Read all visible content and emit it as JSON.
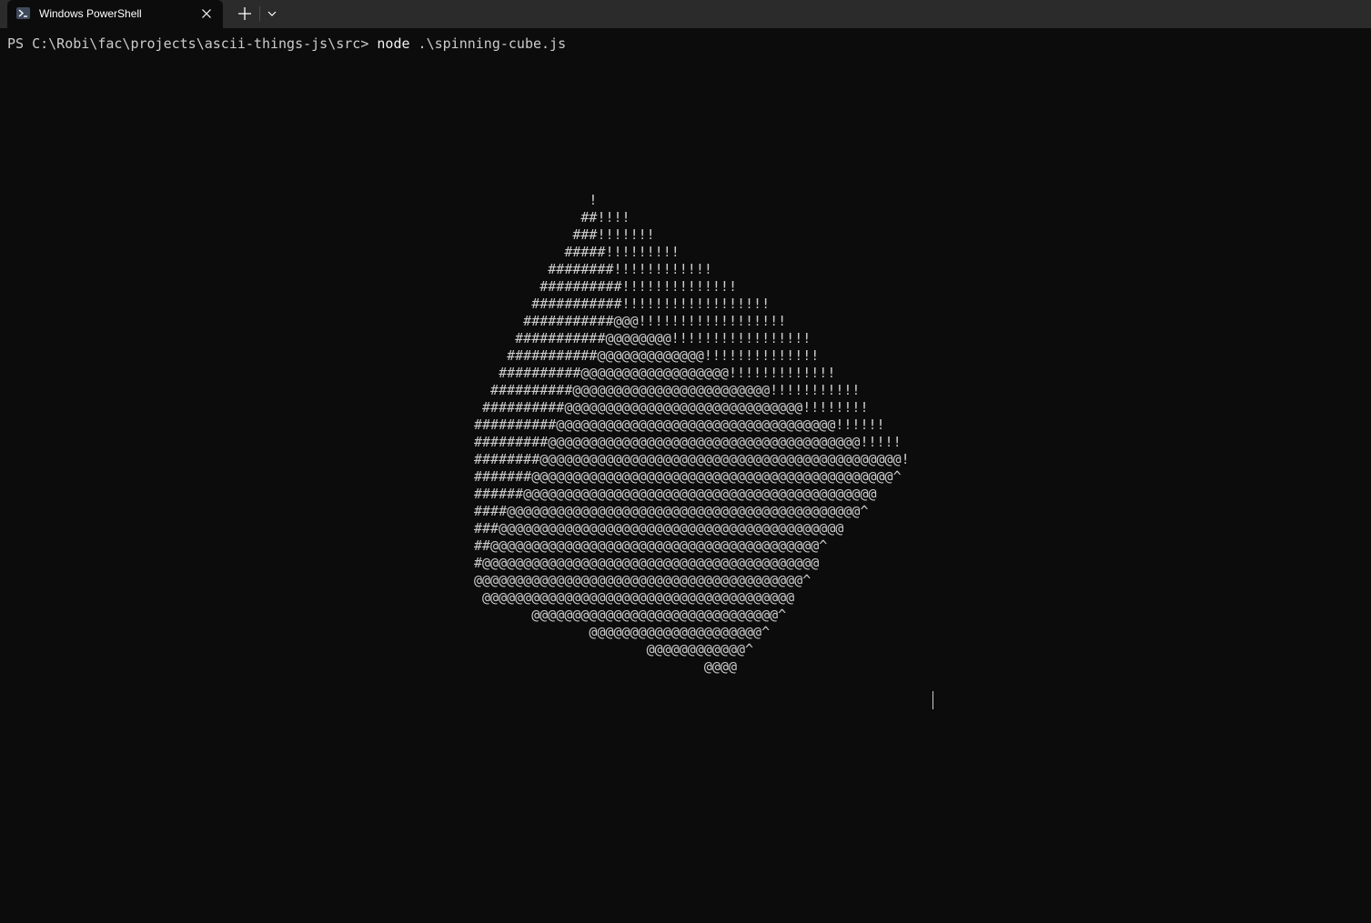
{
  "window": {
    "tab_title": "Windows PowerShell"
  },
  "terminal": {
    "prompt": "PS C:\\Robi\\fac\\projects\\ascii-things-js\\src>",
    "command": "node",
    "argument": ".\\spinning-cube.js",
    "ascii_art": [
      "              !",
      "             ##!!!!",
      "            ###!!!!!!!",
      "           #####!!!!!!!!!",
      "         ########!!!!!!!!!!!!",
      "        ##########!!!!!!!!!!!!!!",
      "       ###########!!!!!!!!!!!!!!!!!!",
      "      ###########@@@!!!!!!!!!!!!!!!!!!",
      "     ###########@@@@@@@@!!!!!!!!!!!!!!!!!",
      "    ###########@@@@@@@@@@@@@!!!!!!!!!!!!!!",
      "   ##########@@@@@@@@@@@@@@@@@@!!!!!!!!!!!!!",
      "  ##########@@@@@@@@@@@@@@@@@@@@@@@@!!!!!!!!!!!",
      " ##########@@@@@@@@@@@@@@@@@@@@@@@@@@@@@!!!!!!!!",
      "##########@@@@@@@@@@@@@@@@@@@@@@@@@@@@@@@@@@!!!!!!",
      "#########@@@@@@@@@@@@@@@@@@@@@@@@@@@@@@@@@@@@@@!!!!!",
      "########@@@@@@@@@@@@@@@@@@@@@@@@@@@@@@@@@@@@@@@@@@@@!",
      "#######@@@@@@@@@@@@@@@@@@@@@@@@@@@@@@@@@@@@@@@@@@@@^",
      "######@@@@@@@@@@@@@@@@@@@@@@@@@@@@@@@@@@@@@@@@@@@",
      "####@@@@@@@@@@@@@@@@@@@@@@@@@@@@@@@@@@@@@@@@@@@^",
      "###@@@@@@@@@@@@@@@@@@@@@@@@@@@@@@@@@@@@@@@@@@",
      "##@@@@@@@@@@@@@@@@@@@@@@@@@@@@@@@@@@@@@@@@^",
      "#@@@@@@@@@@@@@@@@@@@@@@@@@@@@@@@@@@@@@@@@@",
      "@@@@@@@@@@@@@@@@@@@@@@@@@@@@@@@@@@@@@@@@^",
      " @@@@@@@@@@@@@@@@@@@@@@@@@@@@@@@@@@@@@@",
      "       @@@@@@@@@@@@@@@@@@@@@@@@@@@@@@^",
      "              @@@@@@@@@@@@@@@@@@@@@^",
      "                     @@@@@@@@@@@@^",
      "                            @@@@"
    ]
  }
}
